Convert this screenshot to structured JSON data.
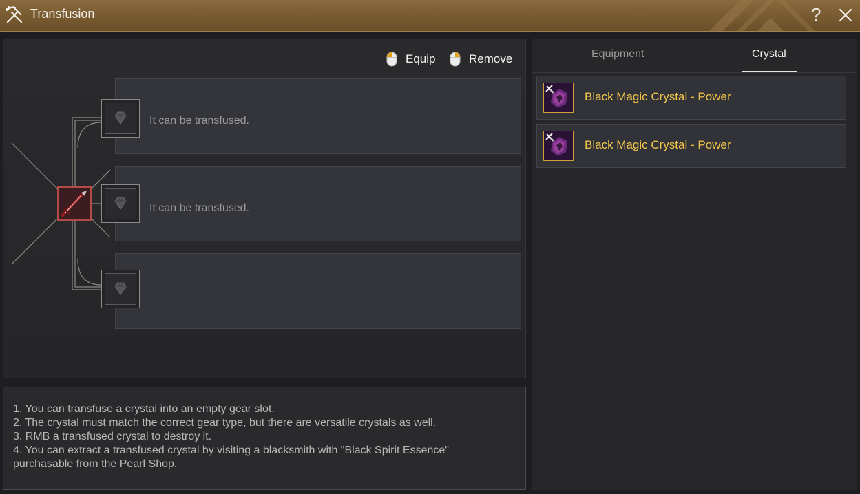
{
  "window": {
    "title": "Transfusion",
    "help_label": "?"
  },
  "hints": {
    "equip_label": "Equip",
    "remove_label": "Remove"
  },
  "slots": [
    {
      "text": "It can be transfused."
    },
    {
      "text": "It can be transfused."
    },
    {
      "text": ""
    }
  ],
  "instructions": {
    "lines": [
      "1. You can transfuse a crystal into an empty gear slot.",
      "2. The crystal must match the correct gear type, but there are versatile crystals as well.",
      "3. RMB a transfused crystal to destroy it.",
      "4. You can extract a transfused crystal by visiting a blacksmith with \"Black Spirit Essence\"",
      "purchasable from the Pearl Shop."
    ]
  },
  "tabs": {
    "equipment_label": "Equipment",
    "crystal_label": "Crystal",
    "active": "Crystal"
  },
  "crystals": [
    {
      "name": "Black Magic Crystal - Power",
      "icon": "black-magic-crystal-icon"
    },
    {
      "name": "Black Magic Crystal - Power",
      "icon": "black-magic-crystal-icon"
    }
  ],
  "colors": {
    "titlebar": "#7a5c33",
    "crystal_name": "#f0c54a",
    "weapon_border": "#b44a48"
  }
}
